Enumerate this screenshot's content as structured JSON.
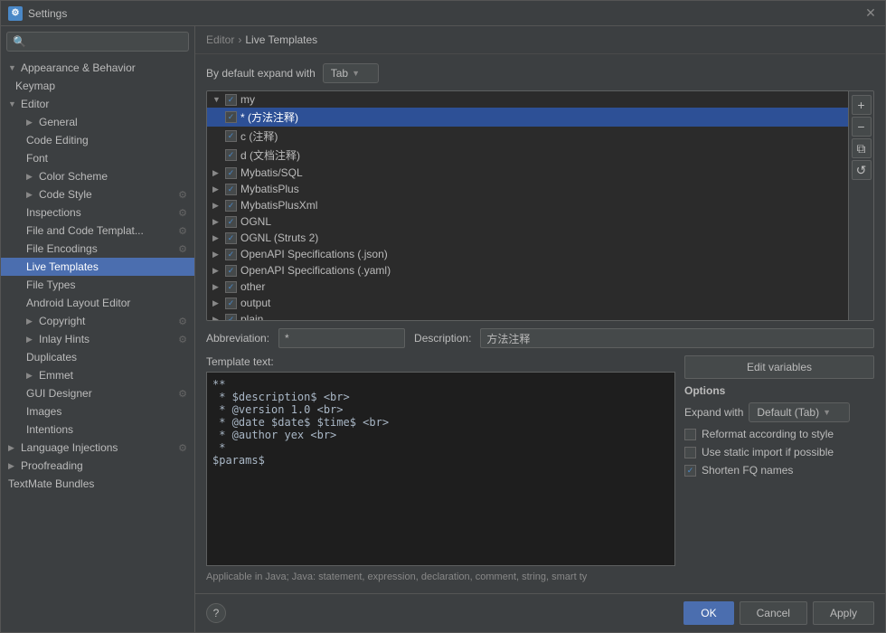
{
  "window": {
    "title": "Settings",
    "icon": "⚙"
  },
  "search": {
    "placeholder": ""
  },
  "sidebar": {
    "appearance_behavior": {
      "label": "Appearance & Behavior",
      "expanded": true
    },
    "keymap": {
      "label": "Keymap"
    },
    "editor": {
      "label": "Editor",
      "expanded": true,
      "children": {
        "general": {
          "label": "General",
          "has_arrow": true
        },
        "code_editing": {
          "label": "Code Editing"
        },
        "font": {
          "label": "Font"
        },
        "color_scheme": {
          "label": "Color Scheme",
          "has_arrow": true
        },
        "code_style": {
          "label": "Code Style",
          "has_arrow": true
        },
        "inspections": {
          "label": "Inspections"
        },
        "file_and_code_template": {
          "label": "File and Code Templat..."
        },
        "file_encodings": {
          "label": "File Encodings"
        },
        "live_templates": {
          "label": "Live Templates",
          "selected": true
        },
        "file_types": {
          "label": "File Types"
        },
        "android_layout_editor": {
          "label": "Android Layout Editor"
        },
        "copyright": {
          "label": "Copyright",
          "has_arrow": true
        },
        "inlay_hints": {
          "label": "Inlay Hints",
          "has_arrow": true
        },
        "duplicates": {
          "label": "Duplicates"
        },
        "emmet": {
          "label": "Emmet",
          "has_arrow": true
        },
        "gui_designer": {
          "label": "GUI Designer"
        },
        "images": {
          "label": "Images"
        },
        "intentions": {
          "label": "Intentions"
        }
      }
    },
    "language_injections": {
      "label": "Language Injections",
      "has_arrow": true
    },
    "proofreading": {
      "label": "Proofreading",
      "has_arrow": true
    },
    "textmate_bundles": {
      "label": "TextMate Bundles"
    }
  },
  "breadcrumb": {
    "parent": "Editor",
    "separator": "›",
    "current": "Live Templates"
  },
  "expand_default": {
    "label": "By default expand with",
    "value": "Tab"
  },
  "templates": [
    {
      "group": "my",
      "expanded": true,
      "checked": true,
      "items": [
        {
          "name": "* (方法注释)",
          "checked": true,
          "selected": true
        },
        {
          "name": "c (注释)",
          "checked": true
        },
        {
          "name": "d (文档注释)",
          "checked": true
        }
      ]
    },
    {
      "group": "Mybatis/SQL",
      "expanded": false,
      "checked": true,
      "items": []
    },
    {
      "group": "MybatisPlus",
      "expanded": false,
      "checked": true,
      "items": []
    },
    {
      "group": "MybatisPlusXml",
      "expanded": false,
      "checked": true,
      "items": []
    },
    {
      "group": "OGNL",
      "expanded": false,
      "checked": true,
      "items": []
    },
    {
      "group": "OGNL (Struts 2)",
      "expanded": false,
      "checked": true,
      "items": []
    },
    {
      "group": "OpenAPI Specifications (.json)",
      "expanded": false,
      "checked": true,
      "items": []
    },
    {
      "group": "OpenAPI Specifications (.yaml)",
      "expanded": false,
      "checked": true,
      "items": []
    },
    {
      "group": "other",
      "expanded": false,
      "checked": true,
      "items": []
    },
    {
      "group": "output",
      "expanded": false,
      "checked": true,
      "items": []
    },
    {
      "group": "plain",
      "expanded": false,
      "checked": true,
      "items": []
    }
  ],
  "side_buttons": {
    "add": "+",
    "remove": "−",
    "copy": "⧉",
    "undo": "↺"
  },
  "abbreviation": {
    "label": "Abbreviation:",
    "value": "*"
  },
  "description": {
    "label": "Description:",
    "value": "方法注释"
  },
  "template_text": {
    "label": "Template text:",
    "lines": [
      "**",
      " * $description$ <br>",
      " * @version 1.0 <br>",
      " * @date $date$ $time$ <br>",
      " * @author yex <br>",
      " *",
      "$params$"
    ]
  },
  "applicable_in": {
    "text": "Applicable in Java; Java: statement, expression, declaration, comment, string, smart ty"
  },
  "options": {
    "label": "Options",
    "edit_variables": "Edit variables",
    "expand_with_label": "Expand with",
    "expand_with_value": "Default (Tab)",
    "reformat": {
      "label": "Reformat according to style",
      "checked": false
    },
    "static_import": {
      "label": "Use static import if possible",
      "checked": false
    },
    "shorten_fq": {
      "label": "Shorten FQ names",
      "checked": true
    }
  },
  "bottom": {
    "ok": "OK",
    "cancel": "Cancel",
    "apply": "Apply",
    "help": "?"
  }
}
